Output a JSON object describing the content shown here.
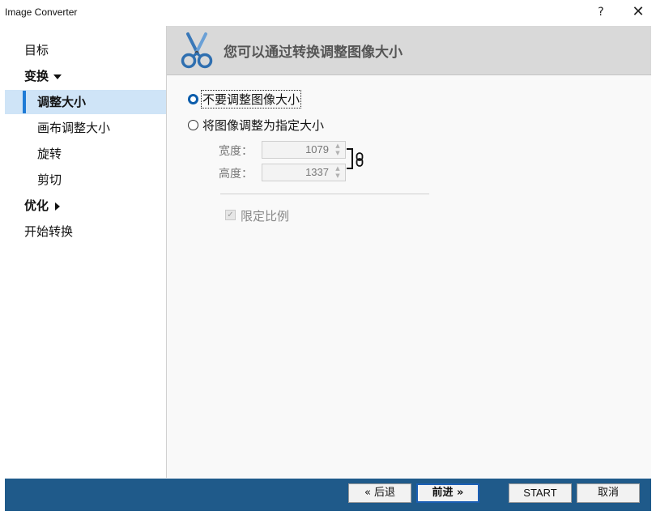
{
  "window": {
    "title": "Image Converter",
    "help": "?",
    "close": "✕"
  },
  "sidebar": {
    "items": [
      {
        "label": "目标"
      },
      {
        "label": "变换"
      },
      {
        "label": "调整大小"
      },
      {
        "label": "画布调整大小"
      },
      {
        "label": "旋转"
      },
      {
        "label": "剪切"
      },
      {
        "label": "优化"
      },
      {
        "label": "开始转换"
      }
    ]
  },
  "header": {
    "title": "您可以通过转换调整图像大小",
    "icon": "scissors-icon"
  },
  "options": {
    "no_resize": "不要调整图像大小",
    "resize_to": "将图像调整为指定大小",
    "width_label": "宽度：",
    "height_label": "高度：",
    "width_value": "1079",
    "height_value": "1337",
    "keep_ratio": "限定比例"
  },
  "footer": {
    "back": "« 后退",
    "next": "前进 »",
    "start": "START",
    "cancel": "取消"
  },
  "colors": {
    "footer_bg": "#1f5a8a",
    "selected_bg": "#cfe4f7",
    "accent": "#1e7bd6"
  }
}
